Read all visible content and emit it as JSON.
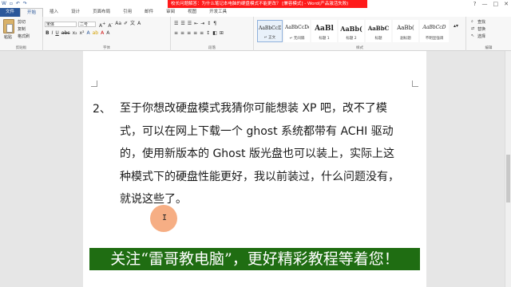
{
  "titlebar": {
    "title": "校长问题解答：为什么笔记本电脑的硬盘模式不能更改？ [兼容模式] - Word(产品激活失败)",
    "qat_icons": [
      "save-icon",
      "undo-icon",
      "redo-icon"
    ],
    "window_controls": [
      "?",
      "—",
      "□",
      "✕"
    ]
  },
  "tabs": [
    {
      "label": "文件"
    },
    {
      "label": "开始"
    },
    {
      "label": "插入"
    },
    {
      "label": "设计"
    },
    {
      "label": "页面布局"
    },
    {
      "label": "引用"
    },
    {
      "label": "邮件"
    },
    {
      "label": "审阅"
    },
    {
      "label": "视图"
    },
    {
      "label": "开发工具"
    }
  ],
  "ribbon": {
    "clipboard": {
      "paste": "粘贴",
      "cut": "剪切",
      "copy": "复制",
      "format_painter": "格式刷",
      "group": "剪贴板"
    },
    "font": {
      "font_name": "宋体",
      "font_size": "二号",
      "group": "字体"
    },
    "paragraph": {
      "group": "段落"
    },
    "styles": {
      "group": "样式",
      "items": [
        {
          "sample": "AaBbCcDd",
          "name": "↵ 正文"
        },
        {
          "sample": "AaBbCcDd",
          "name": "↵ 无间隔"
        },
        {
          "sample": "AaBl",
          "name": "标题 1"
        },
        {
          "sample": "AaBb(",
          "name": "标题 2"
        },
        {
          "sample": "AaBbC",
          "name": "标题"
        },
        {
          "sample": "AaBb(",
          "name": "副标题"
        },
        {
          "sample": "AaBbCcD",
          "name": "不明显强调"
        }
      ]
    },
    "editing": {
      "find": "查找",
      "replace": "替换",
      "select": "选择",
      "group": "编辑"
    }
  },
  "document": {
    "item_number": "2、",
    "lines": [
      "至于你想改硬盘模式我猜你可能想装 XP 吧，改不了模",
      "式，可以在网上下载一个 ghost 系统都带有 ACHI 驱动",
      "的，使用新版本的 Ghost 版光盘也可以装上，实际上这",
      "种模式下的硬盘性能更好，我以前装过，什么问题没有，",
      "就说这些了。"
    ]
  },
  "banner": {
    "text": "关注“雷哥教电脑”，更好精彩教程等着您！"
  },
  "colors": {
    "title_highlight": "#ff1a1a",
    "file_tab": "#2b579a",
    "banner_bg": "#1f6d12",
    "cursor_dot": "#f5a06e"
  }
}
